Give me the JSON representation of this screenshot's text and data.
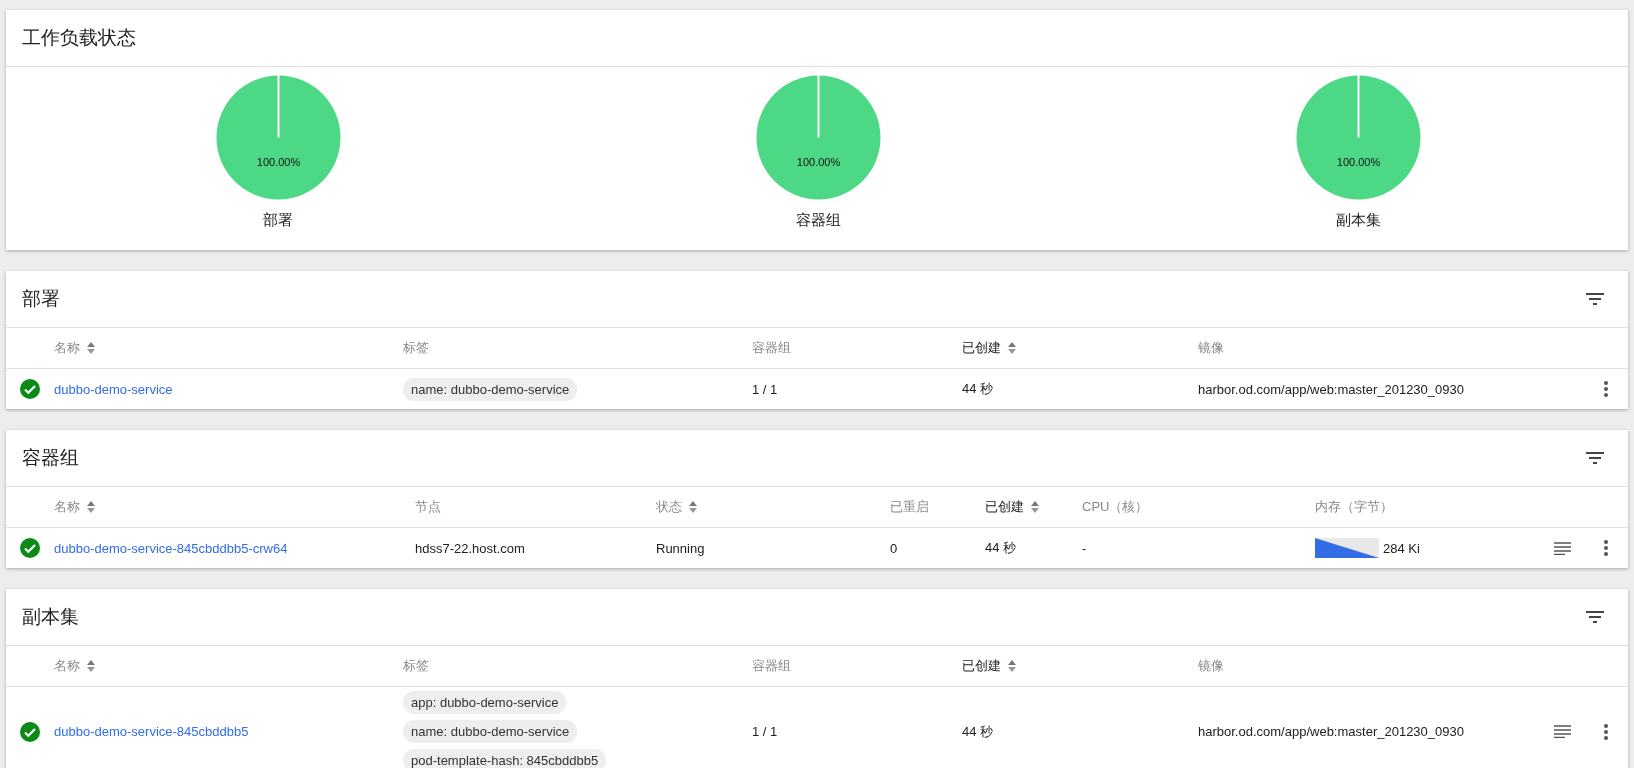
{
  "workload_status": {
    "title": "工作负载状态",
    "charts": [
      {
        "chart_data": {
          "type": "pie",
          "title": "部署",
          "values": [
            100
          ],
          "value_labels": [
            "100.00%"
          ]
        }
      },
      {
        "chart_data": {
          "type": "pie",
          "title": "容器组",
          "values": [
            100
          ],
          "value_labels": [
            "100.00%"
          ]
        }
      },
      {
        "chart_data": {
          "type": "pie",
          "title": "副本集",
          "values": [
            100
          ],
          "value_labels": [
            "100.00%"
          ]
        }
      }
    ]
  },
  "tables": [
    {
      "kind": "deployments",
      "title": "部署",
      "columns": [
        {
          "label": "名称",
          "sortable": true,
          "active": false
        },
        {
          "label": "标签",
          "sortable": false,
          "active": false
        },
        {
          "label": "容器组",
          "sortable": false,
          "active": false
        },
        {
          "label": "已创建",
          "sortable": true,
          "active": true
        },
        {
          "label": "镜像",
          "sortable": false,
          "active": false
        }
      ],
      "rows": [
        {
          "healthy": true,
          "has_logs": false,
          "cells": [
            {
              "kind": "link",
              "text": "dubbo-demo-service"
            },
            {
              "kind": "chips",
              "chips": [
                "name: dubbo-demo-service"
              ]
            },
            {
              "kind": "text",
              "text": "1 / 1"
            },
            {
              "kind": "text",
              "text": "44 秒"
            },
            {
              "kind": "text",
              "text": "harbor.od.com/app/web:master_201230_0930"
            }
          ]
        }
      ]
    },
    {
      "kind": "pods",
      "title": "容器组",
      "columns": [
        {
          "label": "名称",
          "sortable": true,
          "active": false
        },
        {
          "label": "节点",
          "sortable": false,
          "active": false
        },
        {
          "label": "状态",
          "sortable": true,
          "active": false
        },
        {
          "label": "已重启",
          "sortable": false,
          "active": false
        },
        {
          "label": "已创建",
          "sortable": true,
          "active": true
        },
        {
          "label": "CPU（核）",
          "sortable": false,
          "active": false
        },
        {
          "label": "内存（字节）",
          "sortable": false,
          "active": false
        }
      ],
      "rows": [
        {
          "healthy": true,
          "has_logs": true,
          "cells": [
            {
              "kind": "link",
              "text": "dubbo-demo-service-845cbddbb5-crw64"
            },
            {
              "kind": "text",
              "text": "hdss7-22.host.com"
            },
            {
              "kind": "text",
              "text": "Running"
            },
            {
              "kind": "text",
              "text": "0"
            },
            {
              "kind": "text",
              "text": "44 秒"
            },
            {
              "kind": "text",
              "text": "-"
            },
            {
              "kind": "sparkline",
              "text": "284 Ki"
            }
          ]
        }
      ]
    },
    {
      "kind": "replicasets",
      "title": "副本集",
      "columns": [
        {
          "label": "名称",
          "sortable": true,
          "active": false
        },
        {
          "label": "标签",
          "sortable": false,
          "active": false
        },
        {
          "label": "容器组",
          "sortable": false,
          "active": false
        },
        {
          "label": "已创建",
          "sortable": true,
          "active": true
        },
        {
          "label": "镜像",
          "sortable": false,
          "active": false
        }
      ],
      "rows": [
        {
          "healthy": true,
          "has_logs": true,
          "cells": [
            {
              "kind": "link",
              "text": "dubbo-demo-service-845cbddbb5"
            },
            {
              "kind": "chips",
              "chips": [
                "app: dubbo-demo-service",
                "name: dubbo-demo-service",
                "pod-template-hash: 845cbddbb5"
              ]
            },
            {
              "kind": "text",
              "text": "1 / 1"
            },
            {
              "kind": "text",
              "text": "44 秒"
            },
            {
              "kind": "text",
              "text": "harbor.od.com/app/web:master_201230_0930"
            }
          ]
        }
      ]
    }
  ]
}
